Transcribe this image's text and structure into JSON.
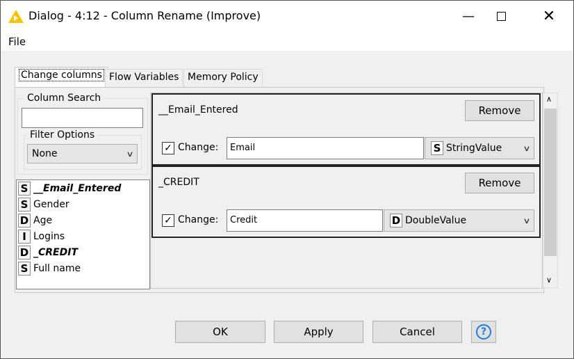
{
  "window": {
    "title": "Dialog - 4:12 - Column Rename (Improve)",
    "icon": "knime-triangle-icon",
    "accent": "#f5c400"
  },
  "menu": {
    "file": "File"
  },
  "tabs": [
    {
      "label": "Change columns",
      "active": true
    },
    {
      "label": "Flow Variables"
    },
    {
      "label": "Memory Policy"
    }
  ],
  "left": {
    "search_label": "Column Search",
    "search_value": "",
    "filter_label": "Filter Options",
    "filter_value": "None",
    "columns": [
      {
        "type": "S",
        "name": "__Email_Entered",
        "bold": true
      },
      {
        "type": "S",
        "name": "Gender"
      },
      {
        "type": "D",
        "name": "Age"
      },
      {
        "type": "I",
        "name": "Logins"
      },
      {
        "type": "D",
        "name": "_CREDIT",
        "bold": true
      },
      {
        "type": "S",
        "name": "Full name"
      }
    ]
  },
  "panels": [
    {
      "column": "__Email_Entered",
      "remove": "Remove",
      "checked": true,
      "change_label": "Change:",
      "new_name": "Email",
      "type_badge": "S",
      "type": "StringValue"
    },
    {
      "column": "_CREDIT",
      "remove": "Remove",
      "checked": true,
      "change_label": "Change:",
      "new_name": "Credit",
      "type_badge": "D",
      "type": "DoubleValue"
    }
  ],
  "buttons": {
    "ok": "OK",
    "apply": "Apply",
    "cancel": "Cancel",
    "help": "?"
  }
}
